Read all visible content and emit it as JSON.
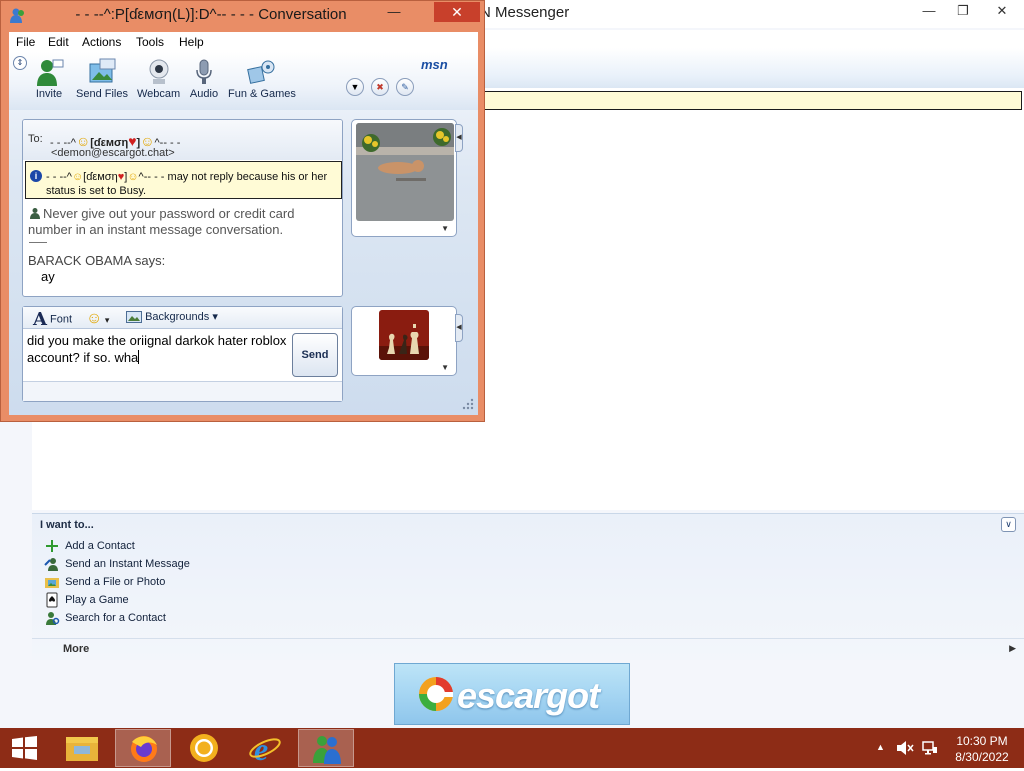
{
  "messenger": {
    "title": "N Messenger",
    "i_want_to": {
      "title": "I want to...",
      "actions": [
        {
          "label": "Add a Contact",
          "icon": "plus-icon"
        },
        {
          "label": "Send an Instant Message",
          "icon": "person-message-icon"
        },
        {
          "label": "Send a File or Photo",
          "icon": "folder-photo-icon"
        },
        {
          "label": "Play a Game",
          "icon": "game-card-icon"
        },
        {
          "label": "Search for a Contact",
          "icon": "search-contact-icon"
        }
      ],
      "more": "More"
    },
    "banner": {
      "text": "escargot"
    }
  },
  "conversation": {
    "title": "- - --^:P[ɗεмση(L)]:D^-- - - - Conversation",
    "menu": [
      "File",
      "Edit",
      "Actions",
      "Tools",
      "Help"
    ],
    "toolbar": [
      {
        "label": "Invite",
        "icon": "invite-person-icon"
      },
      {
        "label": "Send Files",
        "icon": "send-files-icon"
      },
      {
        "label": "Webcam",
        "icon": "webcam-icon"
      },
      {
        "label": "Audio",
        "icon": "microphone-icon"
      },
      {
        "label": "Fun & Games",
        "icon": "fun-games-icon"
      }
    ],
    "logo": "msn",
    "to_label": "To:",
    "contact_name_prefix": "- - --^",
    "contact_name_core": "[ɗεмση",
    "contact_name_suffix": "^-- - -",
    "contact_email": "<demon@escargot.chat>",
    "busy_prefix": "- - --^",
    "busy_core": "[ɗεмση",
    "busy_suffix": "^-- - - may not reply because his or her status is set to Busy.",
    "warning": "Never give out your password or credit card number in an instant message conversation.",
    "says": "BARACK OBAMA says:",
    "message": "ay",
    "composer": {
      "font_label": "Font",
      "backgrounds_label": "Backgrounds",
      "text": "did you make the oriignal darkok hater roblox account? if so. wha",
      "send_label": "Send"
    }
  },
  "taskbar": {
    "time": "10:30 PM",
    "date": "8/30/2022"
  },
  "colors": {
    "taskbar": "#8d2c16",
    "window_frame": "#e98d66",
    "close_button": "#c8402b",
    "notice_bg": "#fffbd6"
  }
}
